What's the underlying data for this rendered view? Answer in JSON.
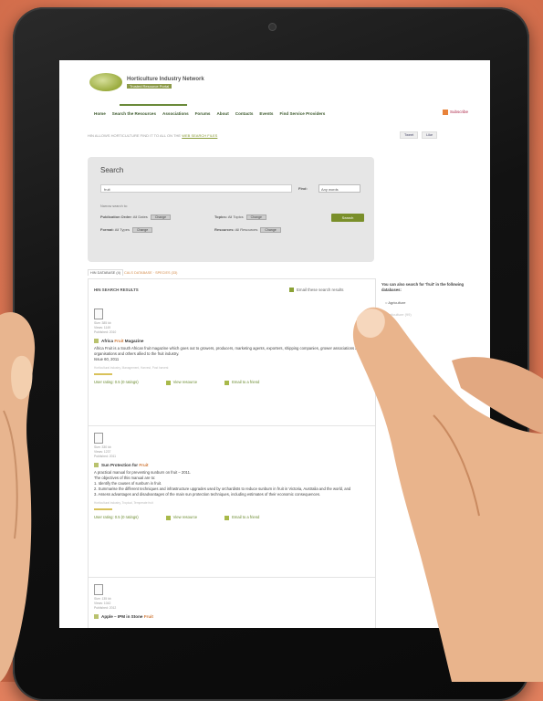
{
  "site": {
    "title": "Horticulture Industry Network",
    "subtitle": "Trusted Resource Portal"
  },
  "nav": {
    "items": [
      "Home",
      "Search the Resources",
      "Associations",
      "Forums",
      "About",
      "Contacts",
      "Events",
      "Find Service Providers"
    ],
    "rss": "Subscribe"
  },
  "topline": {
    "text": "HIN ALLOWS HORTICULTURE FIND IT TO ALL ON THE ",
    "link": "WEB SEARCH FILES"
  },
  "share": [
    "Tweet",
    "Like"
  ],
  "search": {
    "title": "Search",
    "query": "fruit",
    "find_label": "Find:",
    "find_value": "Any words",
    "narrow_label": "Narrow search to:",
    "filters": [
      {
        "label": "Publication Order:",
        "value": "All Dates",
        "chip": "Change"
      },
      {
        "label": "Topics:",
        "value": "All Topics",
        "chip": "Change"
      },
      {
        "label": "Format:",
        "value": "All Types",
        "chip": "Change"
      },
      {
        "label": "Resources:",
        "value": "All Resources",
        "chip": "Change"
      }
    ],
    "button": "Search"
  },
  "tabs": {
    "active": "HIN DATABASE (4)",
    "rest": "CALS DATABASE · SPECIES (33)"
  },
  "results": {
    "heading": "HIN SEARCH RESULTS",
    "email_all": "Email these search results",
    "items": [
      {
        "meta": [
          "Size: 385 kb",
          "Views: 1149",
          "Published: 2010"
        ],
        "title_prefix": "Africa ",
        "title_highlight": "Fruit",
        "title_suffix": " Magazine",
        "desc": "Africa Fruit is a South African fruit magazine which goes out to growers, producers, marketing agents, exporters, shipping companies, grower associations and organisations and others allied to the fruit industry.\nIssue 60, 2011",
        "tags": "Horticultural industry, Management, Harvest, Post harvest",
        "rating": "User rating: 0.5 (0 ratings)",
        "view": "View resource",
        "email": "Email to a friend"
      },
      {
        "meta": [
          "Size: 330 kb",
          "Views: 1237",
          "Published: 2011"
        ],
        "title_prefix": "Sun Protection for ",
        "title_highlight": "Fruit",
        "title_suffix": "",
        "desc": "A practical manual for preventing sunburn on fruit – 2011.\nThe objectives of this manual are to:\n1. Identify the causes of sunburn in fruit.\n2. Summarise the different techniques and infrastructure upgrades used by orchardists to reduce sunburn in fruit in Victoria, Australia and the world, and\n3. Assess advantages and disadvantages of the main sun protection techniques, including estimates of their economic consequences.",
        "tags": "Horticultural industry, Tropical, Temperate fruit",
        "rating": "User rating: 0.5 (0 ratings)",
        "view": "View resource",
        "email": "Email to a friend"
      },
      {
        "meta": [
          "Size: 135 kb",
          "Views: 1042",
          "Published: 2012"
        ],
        "title_prefix": "Apple – IPM in Stone ",
        "title_highlight": "Fruit",
        "title_suffix": ""
      }
    ]
  },
  "sidebar": {
    "note": "You can also search for 'fruit' in the following databases:",
    "option1": "Agriculture",
    "option2": "Horticulture (99)"
  },
  "colors": {
    "background": "#e2805e",
    "accent": "#7a8f2a",
    "highlight": "#d07a3a"
  }
}
